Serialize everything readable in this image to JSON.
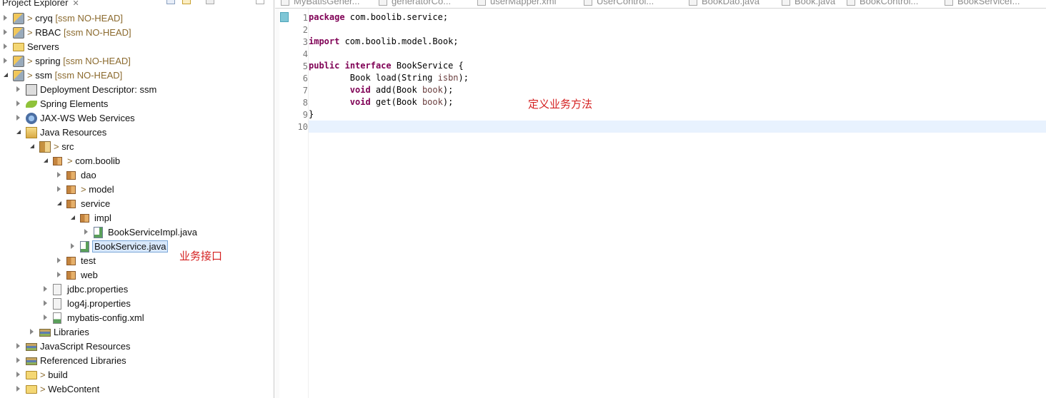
{
  "explorer": {
    "title": "Project Explorer",
    "close_glyph": "✕"
  },
  "tree": [
    {
      "label": "cryq",
      "decoration": "[ssm NO-HEAD]",
      "prefix": ">",
      "icon": "git-project-icon",
      "expanded": false
    },
    {
      "label": "RBAC",
      "decoration": "[ssm NO-HEAD]",
      "prefix": ">",
      "icon": "git-project-icon",
      "expanded": false
    },
    {
      "label": "Servers",
      "decoration": "",
      "prefix": "",
      "icon": "folder-icon",
      "expanded": false
    },
    {
      "label": "spring",
      "decoration": "[ssm NO-HEAD]",
      "prefix": ">",
      "icon": "git-project-icon",
      "expanded": false
    },
    {
      "label": "ssm",
      "decoration": "[ssm NO-HEAD]",
      "prefix": ">",
      "icon": "git-project-icon",
      "expanded": true
    },
    {
      "label": "Deployment Descriptor: ssm",
      "decoration": "",
      "prefix": "",
      "icon": "deployment-descriptor-icon",
      "expanded": false
    },
    {
      "label": "Spring Elements",
      "decoration": "",
      "prefix": "",
      "icon": "spring-leaf-icon",
      "expanded": false
    },
    {
      "label": "JAX-WS Web Services",
      "decoration": "",
      "prefix": "",
      "icon": "web-services-icon",
      "expanded": false
    },
    {
      "label": "Java Resources",
      "decoration": "",
      "prefix": "",
      "icon": "java-resources-icon",
      "expanded": true
    },
    {
      "label": "src",
      "decoration": "",
      "prefix": ">",
      "icon": "source-folder-icon",
      "expanded": true
    },
    {
      "label": "com.boolib",
      "decoration": "",
      "prefix": ">",
      "icon": "package-icon",
      "expanded": true
    },
    {
      "label": "dao",
      "decoration": "",
      "prefix": "",
      "icon": "package-icon",
      "expanded": false
    },
    {
      "label": "model",
      "decoration": "",
      "prefix": ">",
      "icon": "package-icon",
      "expanded": false
    },
    {
      "label": "service",
      "decoration": "",
      "prefix": "",
      "icon": "package-icon",
      "expanded": true
    },
    {
      "label": "impl",
      "decoration": "",
      "prefix": "",
      "icon": "package-icon",
      "expanded": true
    },
    {
      "label": "BookServiceImpl.java",
      "decoration": "",
      "prefix": "",
      "icon": "java-file-icon",
      "expanded": false
    },
    {
      "label": "BookService.java",
      "decoration": "",
      "prefix": "",
      "icon": "java-file-icon",
      "expanded": false,
      "selected": true
    },
    {
      "label": "test",
      "decoration": "",
      "prefix": "",
      "icon": "package-icon",
      "expanded": false
    },
    {
      "label": "web",
      "decoration": "",
      "prefix": "",
      "icon": "package-icon",
      "expanded": false
    },
    {
      "label": "jdbc.properties",
      "decoration": "",
      "prefix": "",
      "icon": "properties-file-icon",
      "expanded": false
    },
    {
      "label": "log4j.properties",
      "decoration": "",
      "prefix": "",
      "icon": "properties-file-icon",
      "expanded": false
    },
    {
      "label": "mybatis-config.xml",
      "decoration": "",
      "prefix": "",
      "icon": "xml-file-icon",
      "expanded": false
    },
    {
      "label": "Libraries",
      "decoration": "",
      "prefix": "",
      "icon": "library-icon",
      "expanded": false
    },
    {
      "label": "JavaScript Resources",
      "decoration": "",
      "prefix": "",
      "icon": "library-icon",
      "expanded": false
    },
    {
      "label": "Referenced Libraries",
      "decoration": "",
      "prefix": "",
      "icon": "library-icon",
      "expanded": false
    },
    {
      "label": "build",
      "decoration": "",
      "prefix": ">",
      "icon": "folder-icon",
      "expanded": false
    },
    {
      "label": "WebContent",
      "decoration": "",
      "prefix": ">",
      "icon": "folder-icon",
      "expanded": false
    }
  ],
  "annotations": {
    "interface_note": "业务接口",
    "method_note": "定义业务方法"
  },
  "editor_tabs": [
    "MyBatisGener...",
    "generatorCo...",
    "userMapper.xml",
    "UserControl...",
    "BookDao.java",
    "Book.java",
    "BookControl...",
    "BookServiceI..."
  ],
  "code": {
    "line_numbers": [
      "1",
      "2",
      "3",
      "4",
      "5",
      "6",
      "7",
      "8",
      "9",
      "10"
    ],
    "lines": [
      [
        {
          "t": "package",
          "c": "kw"
        },
        {
          "t": " com.boolib.service;",
          "c": ""
        }
      ],
      [],
      [
        {
          "t": "import",
          "c": "kw"
        },
        {
          "t": " com.boolib.model.Book;",
          "c": ""
        }
      ],
      [],
      [
        {
          "t": "public",
          "c": "kw"
        },
        {
          "t": " ",
          "c": ""
        },
        {
          "t": "interface",
          "c": "kw"
        },
        {
          "t": " BookService {",
          "c": ""
        }
      ],
      [
        {
          "t": "        Book load(String ",
          "c": ""
        },
        {
          "t": "isbn",
          "c": "par"
        },
        {
          "t": ");",
          "c": ""
        }
      ],
      [
        {
          "t": "        ",
          "c": ""
        },
        {
          "t": "void",
          "c": "kw"
        },
        {
          "t": " add(Book ",
          "c": ""
        },
        {
          "t": "book",
          "c": "par"
        },
        {
          "t": ");",
          "c": ""
        }
      ],
      [
        {
          "t": "        ",
          "c": ""
        },
        {
          "t": "void",
          "c": "kw"
        },
        {
          "t": " get(Book ",
          "c": ""
        },
        {
          "t": "book",
          "c": "par"
        },
        {
          "t": ");",
          "c": ""
        }
      ],
      [
        {
          "t": "}",
          "c": ""
        }
      ],
      []
    ],
    "current_line": 10
  },
  "colors": {
    "keyword": "#7f0055",
    "parameter": "#6a3e3e",
    "annotation_red": "#d42020",
    "current_line_bg": "#e8f2fe",
    "selection_bg": "#d9e8fb"
  }
}
